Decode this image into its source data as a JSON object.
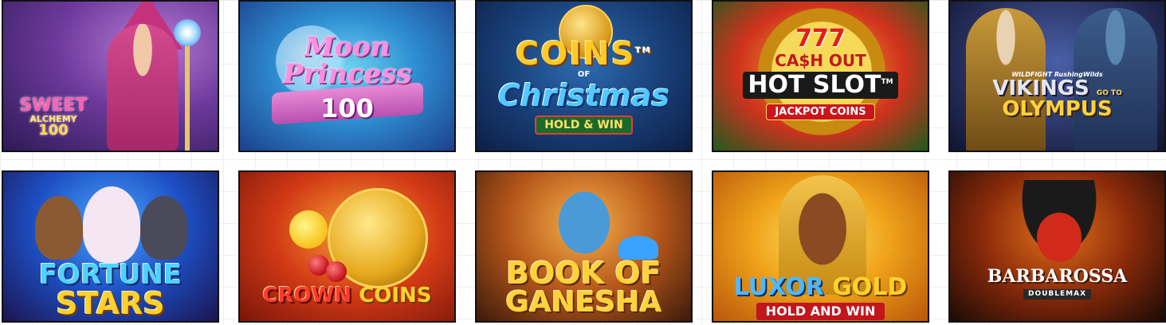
{
  "games": [
    {
      "id_label": "Sweet Alchemy 100",
      "title_lines": [
        "SWEET",
        "ALCHEMY",
        "100"
      ]
    },
    {
      "id_label": "Moon Princess 100",
      "title_lines": [
        "Moon",
        "Princess",
        "100"
      ]
    },
    {
      "id_label": "Coins of Christmas",
      "title_lines": [
        "COINS",
        "OF",
        "Christmas"
      ],
      "trademark": "TM",
      "badge": "HOLD & WIN"
    },
    {
      "id_label": "777 Cash Out Hot Slot",
      "title_lines": [
        "777",
        "CA$H OUT",
        "HOT SLOT"
      ],
      "trademark": "TM",
      "badge": "JACKPOT COINS"
    },
    {
      "id_label": "Vikings Go To Olympus",
      "title_lines": [
        "WILDFIGHT RushingWilds",
        "VIKINGS",
        "OLYMPUS"
      ],
      "subtitle": "GO TO"
    },
    {
      "id_label": "Fortune Stars",
      "title_lines": [
        "FORTUNE",
        "STARS"
      ]
    },
    {
      "id_label": "Crown Coins",
      "title_lines": [
        "CROWN",
        "COINS"
      ]
    },
    {
      "id_label": "Book of Ganesha",
      "title_lines": [
        "BOOK OF",
        "GANESHA"
      ]
    },
    {
      "id_label": "Luxor Gold",
      "title_lines": [
        "LUXOR",
        "GOLD"
      ],
      "badge": "HOLD AND WIN"
    },
    {
      "id_label": "Barbarossa DoubleMax",
      "title_lines": [
        "BARBAROSSA"
      ],
      "badge": "DOUBLEMAX"
    }
  ]
}
